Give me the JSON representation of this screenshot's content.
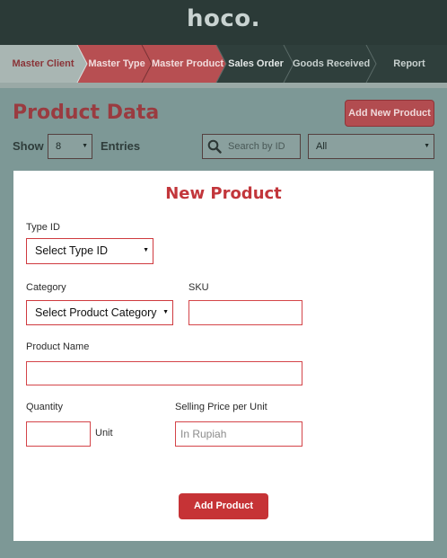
{
  "app": {
    "logo": "hoco."
  },
  "steps": [
    {
      "label": "Master Client"
    },
    {
      "label": "Master Type"
    },
    {
      "label": "Master Product"
    },
    {
      "label": "Sales Order"
    },
    {
      "label": "Goods Received"
    },
    {
      "label": "Report"
    }
  ],
  "colors": {
    "step_done": "#a9b6b3",
    "step_active": "#b74f52",
    "step_pending": "#2f3f3c",
    "accent": "#c2363b"
  },
  "header": {
    "title": "Product Data",
    "add_new_label": "Add New Product"
  },
  "controls": {
    "show_label": "Show",
    "show_value": "8",
    "entries_label": "Entries",
    "search_placeholder": "Search by ID",
    "filter_value": "All"
  },
  "form": {
    "title": "New Product",
    "type_id_label": "Type ID",
    "type_id_value": "Select Type ID",
    "category_label": "Category",
    "category_value": "Select Product Category",
    "sku_label": "SKU",
    "product_name_label": "Product Name",
    "quantity_label": "Quantity",
    "unit_label": "Unit",
    "price_label": "Selling Price per Unit",
    "price_placeholder": "In Rupiah",
    "submit_label": "Add Product"
  }
}
